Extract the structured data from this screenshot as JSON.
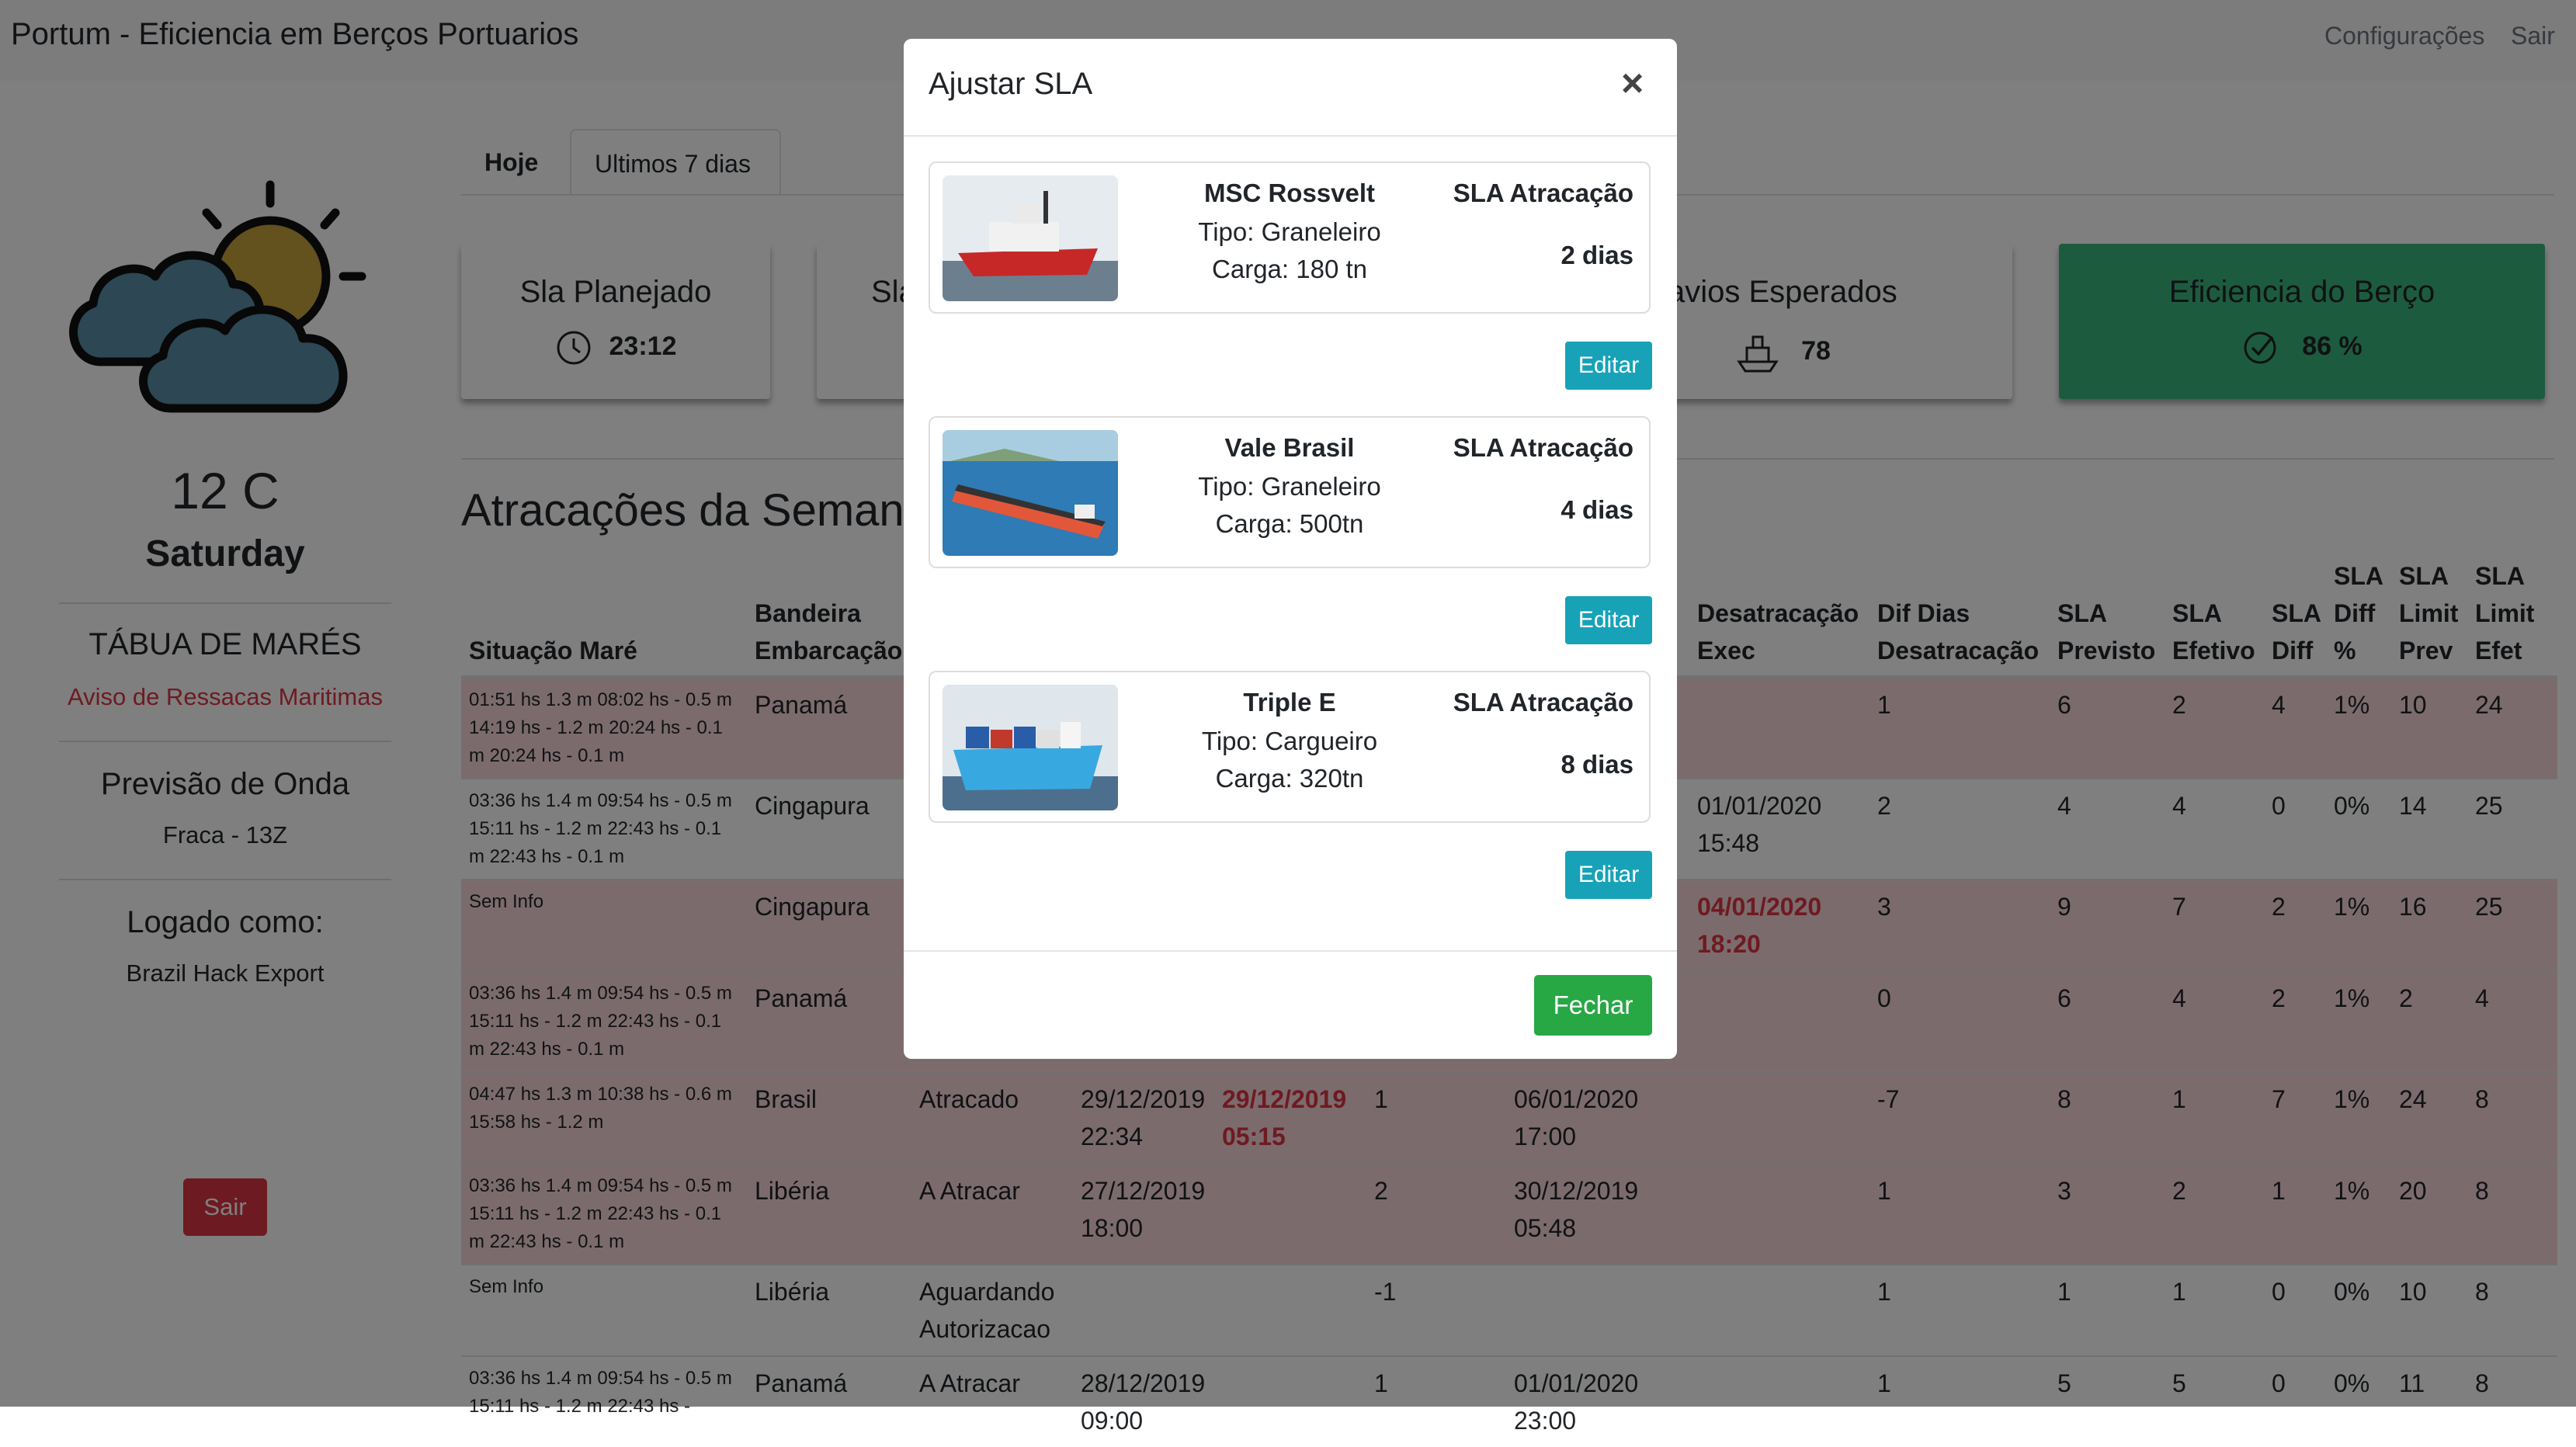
{
  "app": {
    "title": "Portum - Eficiencia em Berços Portuarios",
    "nav": [
      "Configurações",
      "Sair"
    ]
  },
  "sidebar": {
    "weather_icon": "partly-cloudy-icon",
    "temperature": "12 C",
    "day": "Saturday",
    "tides_title": "TÁBUA DE MARÉS",
    "tides_warning": "Aviso de Ressacas Maritimas",
    "wave_title": "Previsão de Onda",
    "wave_value": "Fraca - 13Z",
    "logged_title": "Logado como:",
    "logged_user": "Brazil Hack Export",
    "logout": "Sair"
  },
  "tabs": [
    "Hoje",
    "Ultimos 7 dias"
  ],
  "cards": [
    {
      "title": "Sla Planejado",
      "icon": "clock-icon",
      "value": "23:12"
    },
    {
      "title": "Sla",
      "icon": "",
      "value": ""
    },
    {
      "title": "avios Esperados",
      "icon": "ship-icon",
      "value": "78"
    },
    {
      "title": "Eficiencia do Berço",
      "icon": "check-circle-icon",
      "value": "86 %",
      "color": "#3bb77e"
    }
  ],
  "section_title": "Atracações da Semana",
  "table": {
    "columns": [
      "Situação Maré",
      "Bandeira Embarcação",
      "",
      "",
      "",
      "",
      "",
      "Desatracação Exec",
      "Dif Dias Desatracação",
      "SLA Previsto",
      "SLA Efetivo",
      "SLA Diff",
      "SLA Diff %",
      "SLA Limit Prev",
      "SLA Limit Efet"
    ],
    "rows": [
      {
        "mare": "01:51 hs 1.3 m 08:02 hs - 0.5 m 14:19 hs - 1.2 m 20:24 hs - 0.1 m 20:24 hs - 0.1 m",
        "bandeira": "Panamá",
        "status": "",
        "c4": "",
        "c5": "",
        "c6": "",
        "c7": "",
        "desat_exec": "",
        "dif": "1",
        "prev": "6",
        "efet": "2",
        "diff": "4",
        "diffp": "1%",
        "lprev": "10",
        "lefet": "24",
        "red": true
      },
      {
        "mare": "03:36 hs 1.4 m 09:54 hs - 0.5 m 15:11 hs - 1.2 m 22:43 hs - 0.1 m 22:43 hs - 0.1 m",
        "bandeira": "Cingapura",
        "status": "",
        "c4": "",
        "c5": "",
        "c6": "",
        "c7": "",
        "desat_exec": "01/01/2020 15:48",
        "dif": "2",
        "prev": "4",
        "efet": "4",
        "diff": "0",
        "diffp": "0%",
        "lprev": "14",
        "lefet": "25",
        "red": false
      },
      {
        "mare": "Sem Info",
        "bandeira": "Cingapura",
        "status": "",
        "c4": "",
        "c5": "",
        "c6": "",
        "c7": "",
        "desat_exec": "04/01/2020 18:20",
        "desat_red": true,
        "dif": "3",
        "prev": "9",
        "efet": "7",
        "diff": "2",
        "diffp": "1%",
        "lprev": "16",
        "lefet": "25",
        "red": true
      },
      {
        "mare": "03:36 hs 1.4 m 09:54 hs - 0.5 m 15:11 hs - 1.2 m 22:43 hs - 0.1 m 22:43 hs - 0.1 m",
        "bandeira": "Panamá",
        "status": "",
        "c4": "",
        "c5": "",
        "c6": "",
        "c7": "",
        "desat_exec": "",
        "dif": "0",
        "prev": "6",
        "efet": "4",
        "diff": "2",
        "diffp": "1%",
        "lprev": "2",
        "lefet": "4",
        "red": true
      },
      {
        "mare": "04:47 hs 1.3 m 10:38 hs - 0.6 m 15:58 hs - 1.2 m",
        "bandeira": "Brasil",
        "status": "Atracado",
        "c4": "29/12/2019 22:34",
        "c5": "29/12/2019 05:15",
        "c5_red": true,
        "c6": "1",
        "c7": "06/01/2020 17:00",
        "desat_exec": "",
        "dif": "-7",
        "prev": "8",
        "efet": "1",
        "diff": "7",
        "diffp": "1%",
        "lprev": "24",
        "lefet": "8",
        "red": true
      },
      {
        "mare": "03:36 hs 1.4 m 09:54 hs - 0.5 m 15:11 hs - 1.2 m 22:43 hs - 0.1 m 22:43 hs - 0.1 m",
        "bandeira": "Libéria",
        "status": "A Atracar",
        "c4": "27/12/2019 18:00",
        "c5": "",
        "c6": "2",
        "c7": "30/12/2019 05:48",
        "desat_exec": "",
        "dif": "1",
        "prev": "3",
        "efet": "2",
        "diff": "1",
        "diffp": "1%",
        "lprev": "20",
        "lefet": "8",
        "red": true
      },
      {
        "mare": "Sem Info",
        "bandeira": "Libéria",
        "status": "Aguardando Autorizacao",
        "c4": "",
        "c5": "",
        "c6": "-1",
        "c7": "",
        "desat_exec": "",
        "dif": "1",
        "prev": "1",
        "efet": "1",
        "diff": "0",
        "diffp": "0%",
        "lprev": "10",
        "lefet": "8",
        "red": false
      },
      {
        "mare": "03:36 hs 1.4 m 09:54 hs - 0.5 m 15:11 hs - 1.2 m 22:43 hs -",
        "bandeira": "Panamá",
        "status": "A Atracar",
        "c4": "28/12/2019 09:00",
        "c5": "",
        "c6": "1",
        "c7": "01/01/2020 23:00",
        "desat_exec": "",
        "dif": "1",
        "prev": "5",
        "efet": "5",
        "diff": "0",
        "diffp": "0%",
        "lprev": "11",
        "lefet": "8",
        "red": false
      }
    ]
  },
  "modal": {
    "title": "Ajustar SLA",
    "close": "×",
    "ships": [
      {
        "name": "MSC Rossvelt",
        "tipo": "Tipo: Graneleiro",
        "carga": "Carga: 180 tn",
        "sla_label": "SLA Atracação",
        "sla_value": "2 dias",
        "edit": "Editar",
        "image": "supply-vessel-photo"
      },
      {
        "name": "Vale Brasil",
        "tipo": "Tipo: Graneleiro",
        "carga": "Carga: 500tn",
        "sla_label": "SLA Atracação",
        "sla_value": "4 dias",
        "edit": "Editar",
        "image": "bulk-carrier-photo"
      },
      {
        "name": "Triple E",
        "tipo": "Tipo: Cargueiro",
        "carga": "Carga: 320tn",
        "sla_label": "SLA Atracação",
        "sla_value": "8 dias",
        "edit": "Editar",
        "image": "container-ship-photo"
      }
    ],
    "close_button": "Fechar"
  }
}
